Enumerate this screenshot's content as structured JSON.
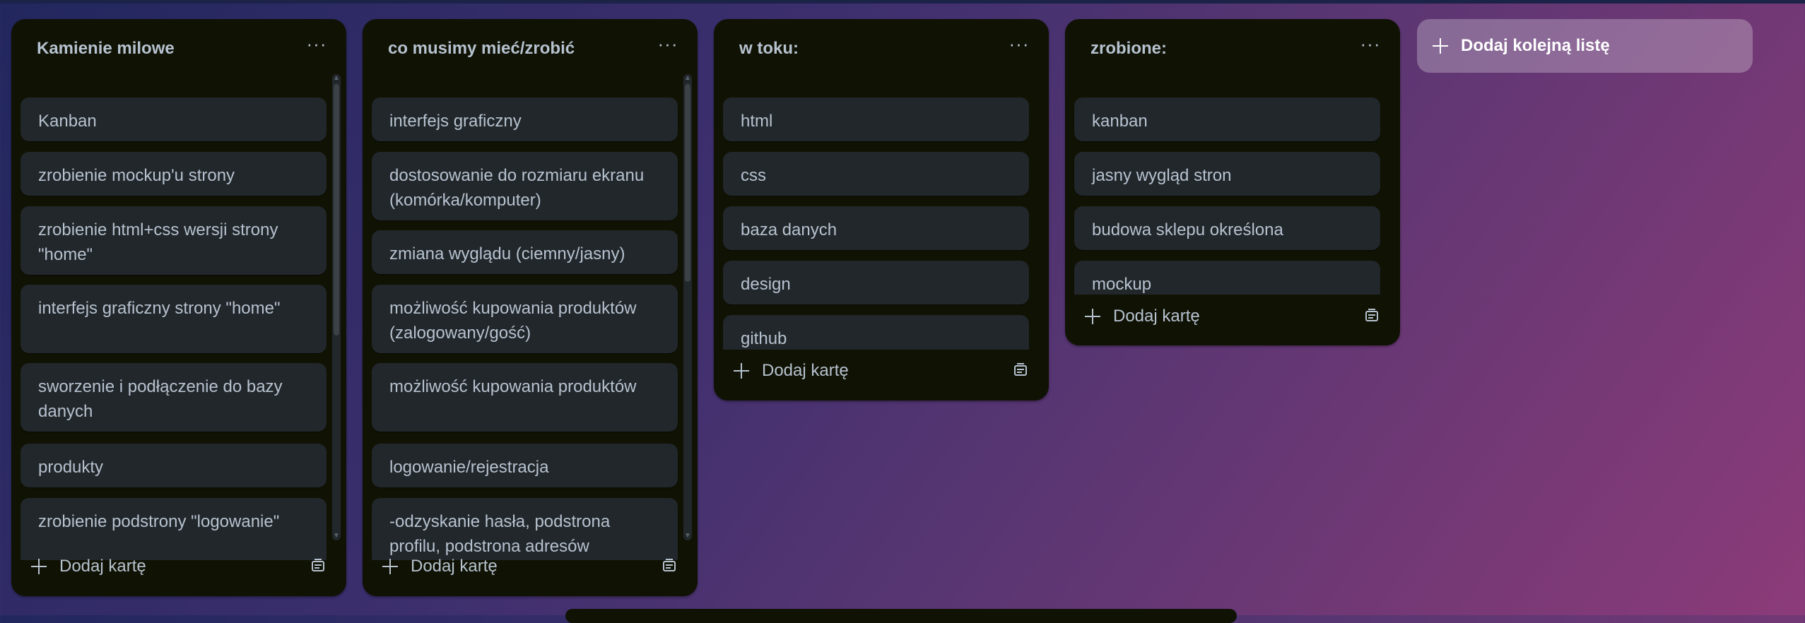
{
  "board": {
    "lists": [
      {
        "title": "Kamienie milowe",
        "cards": [
          "Kanban",
          "zrobienie mockup'u strony",
          "zrobienie html+css wersji strony \"home\"",
          "interfejs graficzny strony \"home\"",
          "sworzenie i podłączenie do bazy danych",
          "produkty",
          "zrobienie podstrony \"logowanie\""
        ],
        "add_card_label": "Dodaj kartę"
      },
      {
        "title": "co musimy mieć/zrobić",
        "cards": [
          "interfejs graficzny",
          "dostosowanie do rozmiaru ekranu (komórka/komputer)",
          "zmiana wyglądu (ciemny/jasny)",
          "możliwość kupowania produktów (zalogowany/gość)",
          "możliwość kupowania produktów",
          "logowanie/rejestracja",
          "-odzyskanie hasła, podstrona profilu, podstrona adresów"
        ],
        "add_card_label": "Dodaj kartę"
      },
      {
        "title": "w toku:",
        "cards": [
          "html",
          "css",
          "baza danych",
          "design",
          "github"
        ],
        "add_card_label": "Dodaj kartę"
      },
      {
        "title": "zrobione:",
        "cards": [
          "kanban",
          "jasny wygląd stron",
          "budowa sklepu określona",
          "mockup"
        ],
        "add_card_label": "Dodaj kartę"
      }
    ],
    "add_list_label": "Dodaj kolejną listę",
    "list_menu_icon": "more-horizontal-icon",
    "add_card_icon": "plus-icon",
    "template_icon": "card-template-icon",
    "colors": {
      "list_bg": "#101204",
      "card_bg": "#22272b",
      "text": "#b6c2cf",
      "add_list_bg": "rgba(255,255,255,0.26)"
    }
  }
}
